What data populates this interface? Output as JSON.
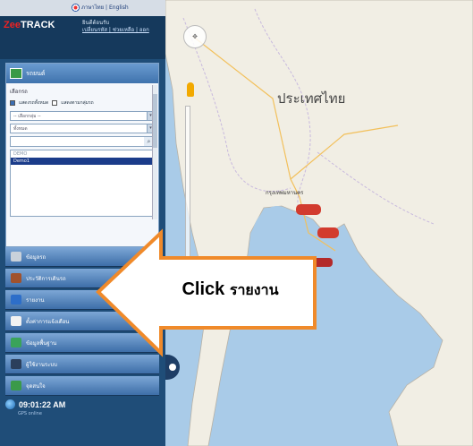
{
  "header": {
    "language_links": "ภาษาไทย | English",
    "logo_text": "ZeeTRACK",
    "welcome": "ยินดีต้อนรับ",
    "account_links": "เปลี่ยนรหัส | ช่วยเหลือ | ออก"
  },
  "panel": {
    "title": "รถยนต์",
    "subtitle": "เลือกรถ",
    "check_all": "แสดงรถทั้งหมด",
    "check_group": "แสดงตามกลุ่มรถ",
    "select_group": "-- เลือกกลุ่ม --",
    "select_status": "ทั้งหมด",
    "search_value": "",
    "list": [
      "DEMO",
      "Demo1"
    ],
    "selected_index": 1
  },
  "menu": {
    "items": [
      {
        "label": "ข้อมูลรถ",
        "icon": "car-icon",
        "color": "#c9d1da"
      },
      {
        "label": "ประวัติการเดินรถ",
        "icon": "history-icon",
        "color": "#a0522d"
      },
      {
        "label": "รายงาน",
        "icon": "report-icon",
        "color": "#2d6ec9"
      },
      {
        "label": "ตั้งค่าการแจ้งเตือน",
        "icon": "bell-icon",
        "color": "#f2f2f2"
      },
      {
        "label": "ข้อมูลพื้นฐาน",
        "icon": "settings-icon",
        "color": "#3aa35a"
      },
      {
        "label": "ผู้ใช้งานระบบ",
        "icon": "user-icon",
        "color": "#2b3f5c"
      },
      {
        "label": "จุดสนใจ",
        "icon": "poi-icon",
        "color": "#3b9a4a"
      }
    ]
  },
  "clock": {
    "time": "09:01:22 AM",
    "sub": "GPS online"
  },
  "map": {
    "country_label": "ประเทศไทย",
    "city_label": "กรุงเทพมหานคร"
  },
  "callout": {
    "bold": "Click",
    "text": "รายงาน"
  },
  "colors": {
    "sidebar": "#1f4d78",
    "callout_fill": "#ffffff",
    "callout_stroke": "#f08a2a",
    "sea": "#a9cbe8",
    "land": "#f1eee4"
  }
}
